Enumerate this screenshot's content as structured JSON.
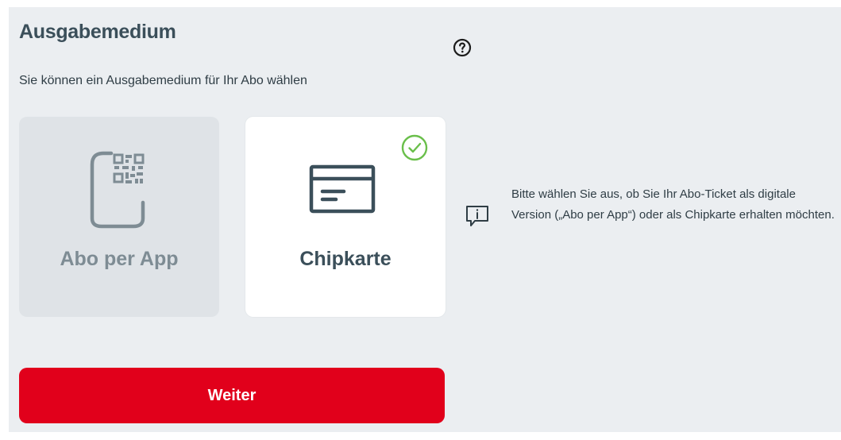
{
  "section": {
    "title": "Ausgabemedium",
    "subtitle": "Sie können ein Ausgabemedium für Ihr Abo wählen",
    "help_icon": "question-circle-icon"
  },
  "options": [
    {
      "label": "Abo per App",
      "icon": "phone-qr-code-icon",
      "selected": false
    },
    {
      "label": "Chipkarte",
      "icon": "credit-card-icon",
      "selected": true,
      "selected_icon": "check-circle-icon"
    }
  ],
  "hint": {
    "icon": "info-speech-bubble-icon",
    "text": "Bitte wählen Sie aus, ob Sie Ihr Abo-Ticket als digitale Version („Abo per App“) oder als Chipkarte erhalten möchten."
  },
  "actions": {
    "continue_label": "Weiter"
  },
  "colors": {
    "accent": "#e1001b",
    "text_dark": "#3b4f5a",
    "panel_bg": "#ebeef1",
    "selected_check": "#6abf4b"
  }
}
